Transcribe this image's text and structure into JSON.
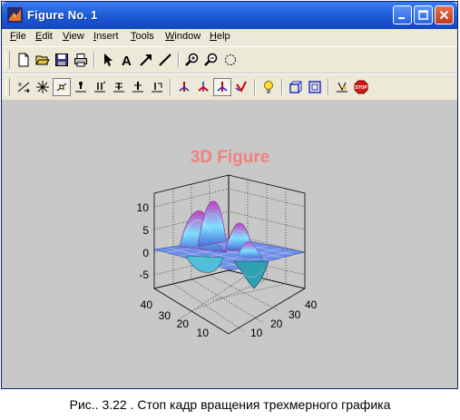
{
  "window": {
    "title": "Figure No. 1",
    "controls": {
      "minimize": "minimize",
      "maximize": "maximize",
      "close": "close"
    }
  },
  "menu": [
    {
      "label": "File",
      "accel": "F",
      "rest": "ile"
    },
    {
      "label": "Edit",
      "accel": "E",
      "rest": "dit"
    },
    {
      "label": "View",
      "accel": "V",
      "rest": "iew"
    },
    {
      "label": "Insert",
      "accel": "I",
      "rest": "nsert"
    },
    {
      "label": "Tools",
      "accel": "T",
      "rest": "ools"
    },
    {
      "label": "Window",
      "accel": "W",
      "rest": "indow"
    },
    {
      "label": "Help",
      "accel": "H",
      "rest": "elp"
    }
  ],
  "toolbar1": [
    "new-file-icon",
    "open-folder-icon",
    "save-icon",
    "print-icon",
    "arrow-select-icon",
    "text-insert-icon",
    "arrow-insert-icon",
    "line-insert-icon",
    "zoom-in-icon",
    "zoom-out-icon",
    "rotate-3d-icon"
  ],
  "toolbar2": [
    "camera-orbit-icon",
    "camera-orbit-scene-light-icon",
    "camera-pan-tilt-icon",
    "camera-move-horizontal-icon",
    "camera-move-forward-back-icon",
    "camera-move-vertical-icon",
    "camera-zoom-icon",
    "camera-roll-icon",
    "principal-axis-x-icon",
    "principal-axis-y-icon",
    "principal-axis-z-icon",
    "principal-axis-none-icon",
    "scene-light-icon",
    "orthographic-projection-icon",
    "perspective-projection-icon",
    "reset-camera-icon",
    "stop-camera-icon"
  ],
  "plot": {
    "title": "3D Figure",
    "z_ticks": [
      "10",
      "5",
      "0",
      "-5"
    ],
    "x_ticks": [
      "40",
      "30",
      "20",
      "10"
    ],
    "y_ticks": [
      "40",
      "30",
      "20",
      "10"
    ],
    "colors": {
      "title": "#f08080",
      "surface_low": "#4a6cd8",
      "surface_mid": "#7fe0ff",
      "surface_high": "#c040c0"
    }
  },
  "caption": "Рис.. 3.22 . Стоп кадр вращения трехмерного графика"
}
